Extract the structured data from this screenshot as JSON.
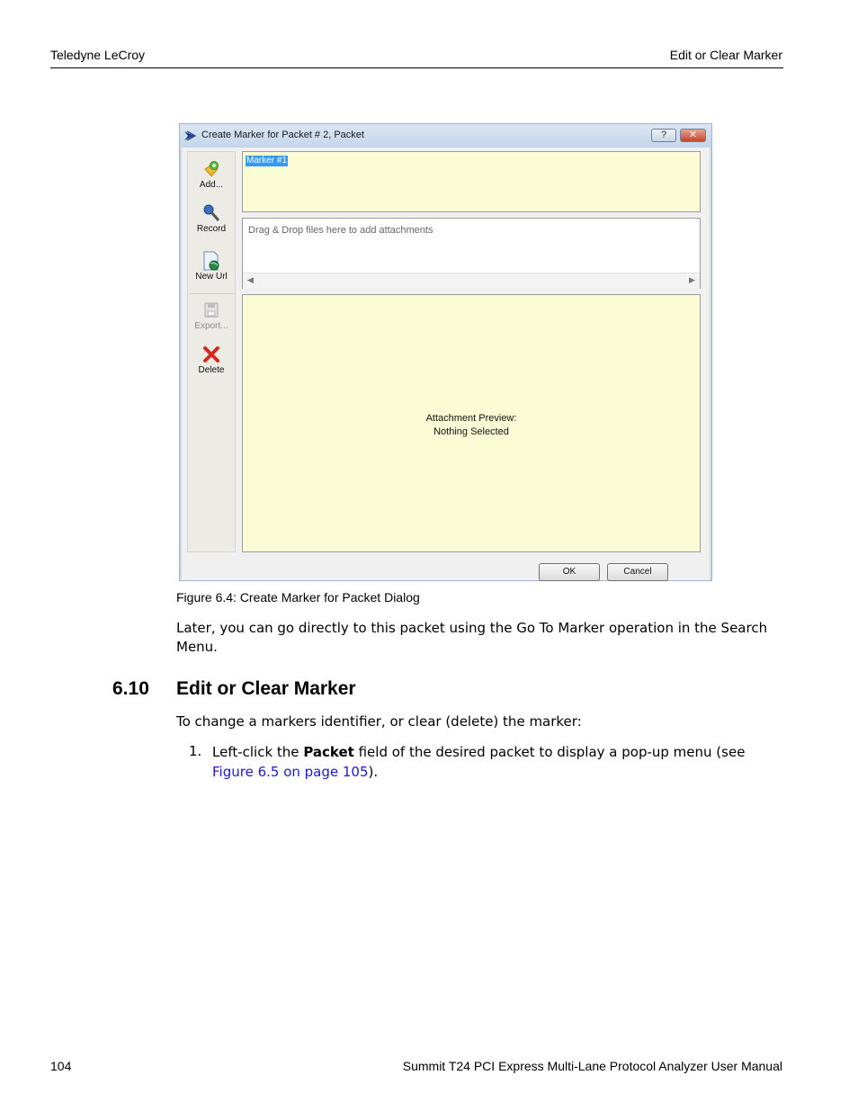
{
  "header": {
    "left": "Teledyne LeCroy",
    "right": "Edit or Clear Marker"
  },
  "dialog": {
    "title": "Create Marker for Packet # 2, Packet",
    "help_label": "?",
    "close_label": "✕",
    "toolbar": {
      "add": "Add...",
      "record": "Record",
      "new_url": "New Url",
      "export": "Export...",
      "delete": "Delete"
    },
    "marker_name": "Marker #1",
    "attach_hint": "Drag & Drop files here to add attachments",
    "preview_line1": "Attachment Preview:",
    "preview_line2": "Nothing Selected",
    "ok_label": "OK",
    "cancel_label": "Cancel"
  },
  "caption": "Figure 6.4:  Create Marker for Packet Dialog",
  "paragraph1": "Later, you can go directly to this packet using the Go To Marker operation in the Search Menu.",
  "section": {
    "number": "6.10",
    "title": "Edit or Clear Marker"
  },
  "paragraph2": "To change a markers identifier, or clear (delete) the marker:",
  "list": {
    "num": "1.",
    "before": "Left-click the ",
    "bold": "Packet",
    "middle": " field of the desired packet to display a pop-up menu (see ",
    "link": "Figure 6.5 on page 105",
    "after": ")."
  },
  "footer": {
    "page": "104",
    "title": "Summit T24 PCI Express Multi-Lane Protocol Analyzer User Manual"
  }
}
